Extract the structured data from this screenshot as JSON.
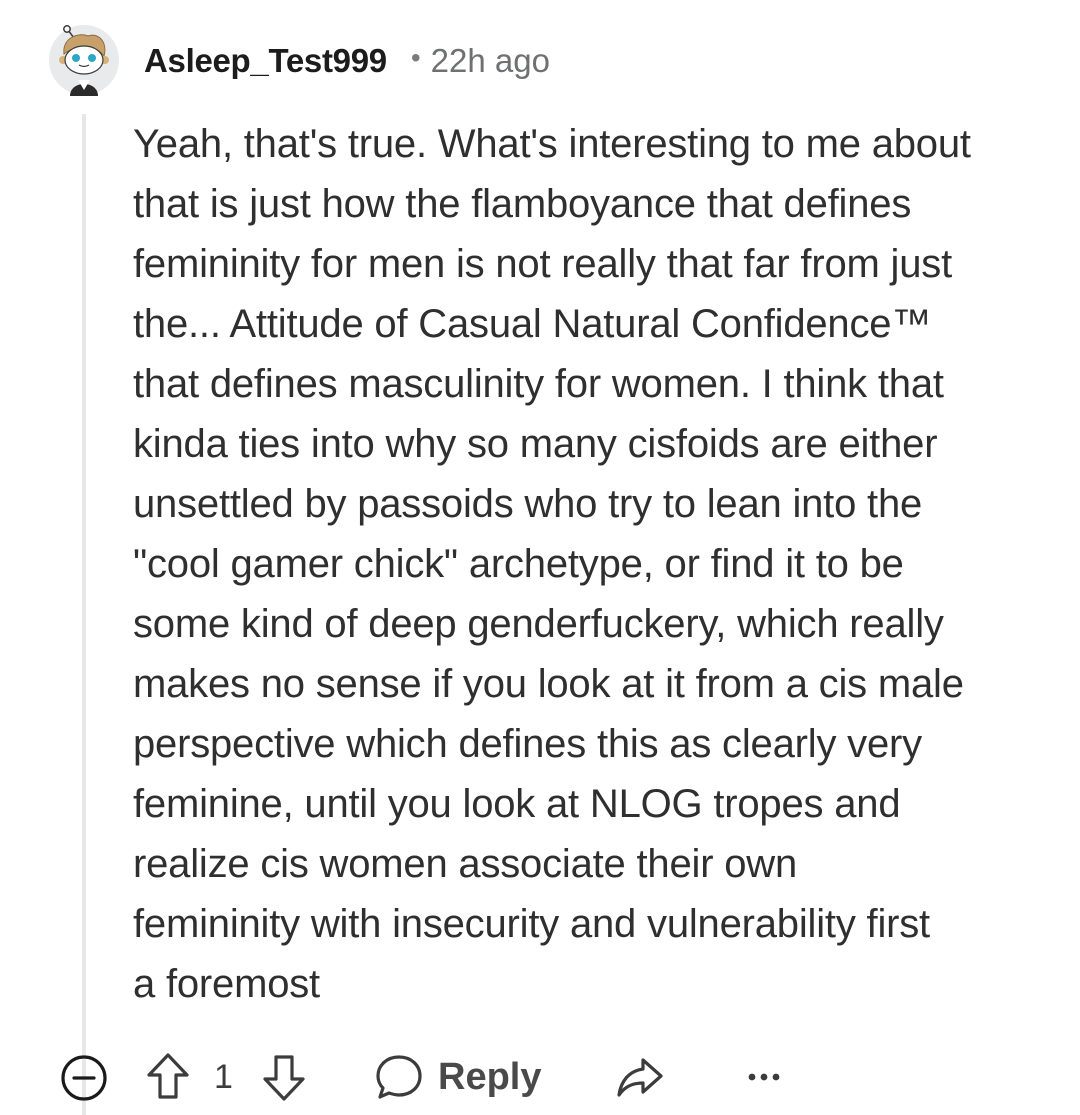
{
  "comment": {
    "author": "Asleep_Test999",
    "separator": "•",
    "timestamp": "22h ago",
    "body": "Yeah, that's true. What's interesting to me about\nthat is just how the flamboyance that defines\nfemininity for men is not really that far from just\nthe... Attitude of Casual Natural Confidence™\nthat defines masculinity for women. I think that\nkinda ties into why so many cisfoids are either\nunsettled by passoids who try to lean into the\n\"cool gamer chick\" archetype, or find it to be\nsome kind of deep genderfuckery, which really\nmakes no sense if you look at it from a cis male\nperspective which defines this as clearly very\nfeminine, until you look at NLOG tropes and\nrealize cis women associate their own\nfemininity with insecurity and vulnerability first\na foremost"
  },
  "actions": {
    "collapse_icon": "collapse-minus-icon",
    "upvote_icon": "upvote-arrow-icon",
    "vote_count": "1",
    "downvote_icon": "downvote-arrow-icon",
    "reply_icon": "speech-bubble-icon",
    "reply_label": "Reply",
    "share_icon": "share-arrow-icon",
    "more_icon": "more-dots-icon"
  },
  "colors": {
    "text": "#2f2f30",
    "muted": "#6f7071",
    "thread_line": "#e7e7e8",
    "icon": "#3c3c3d"
  }
}
